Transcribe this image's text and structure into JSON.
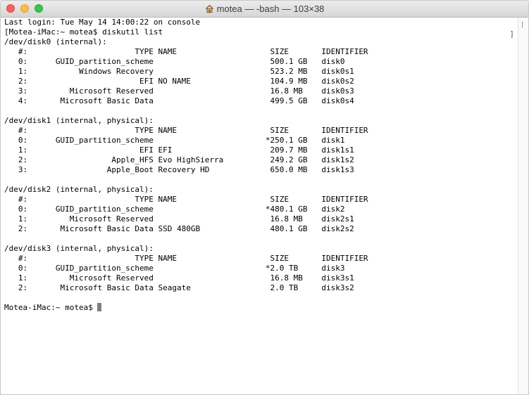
{
  "window": {
    "title": "motea — -bash — 103×38"
  },
  "scrollbar": {
    "marker": "["
  },
  "bracket": "]",
  "terminal": {
    "lines": [
      "Last login: Tue May 14 14:00:22 on console",
      "[Motea-iMac:~ motea$ diskutil list",
      "/dev/disk0 (internal):",
      "   #:                       TYPE NAME                    SIZE       IDENTIFIER",
      "   0:      GUID_partition_scheme                         500.1 GB   disk0",
      "   1:           Windows Recovery                         523.2 MB   disk0s1",
      "   2:                        EFI NO NAME                 104.9 MB   disk0s2",
      "   3:         Microsoft Reserved                         16.8 MB    disk0s3",
      "   4:       Microsoft Basic Data                         499.5 GB   disk0s4",
      "",
      "/dev/disk1 (internal, physical):",
      "   #:                       TYPE NAME                    SIZE       IDENTIFIER",
      "   0:      GUID_partition_scheme                        *250.1 GB   disk1",
      "   1:                        EFI EFI                     209.7 MB   disk1s1",
      "   2:                  Apple_HFS Evo HighSierra          249.2 GB   disk1s2",
      "   3:                 Apple_Boot Recovery HD             650.0 MB   disk1s3",
      "",
      "/dev/disk2 (internal, physical):",
      "   #:                       TYPE NAME                    SIZE       IDENTIFIER",
      "   0:      GUID_partition_scheme                        *480.1 GB   disk2",
      "   1:         Microsoft Reserved                         16.8 MB    disk2s1",
      "   2:       Microsoft Basic Data SSD 480GB               480.1 GB   disk2s2",
      "",
      "/dev/disk3 (internal, physical):",
      "   #:                       TYPE NAME                    SIZE       IDENTIFIER",
      "   0:      GUID_partition_scheme                        *2.0 TB     disk3",
      "   1:         Microsoft Reserved                         16.8 MB    disk3s1",
      "   2:       Microsoft Basic Data Seagate                 2.0 TB     disk3s2",
      ""
    ],
    "prompt": "Motea-iMac:~ motea$ "
  }
}
